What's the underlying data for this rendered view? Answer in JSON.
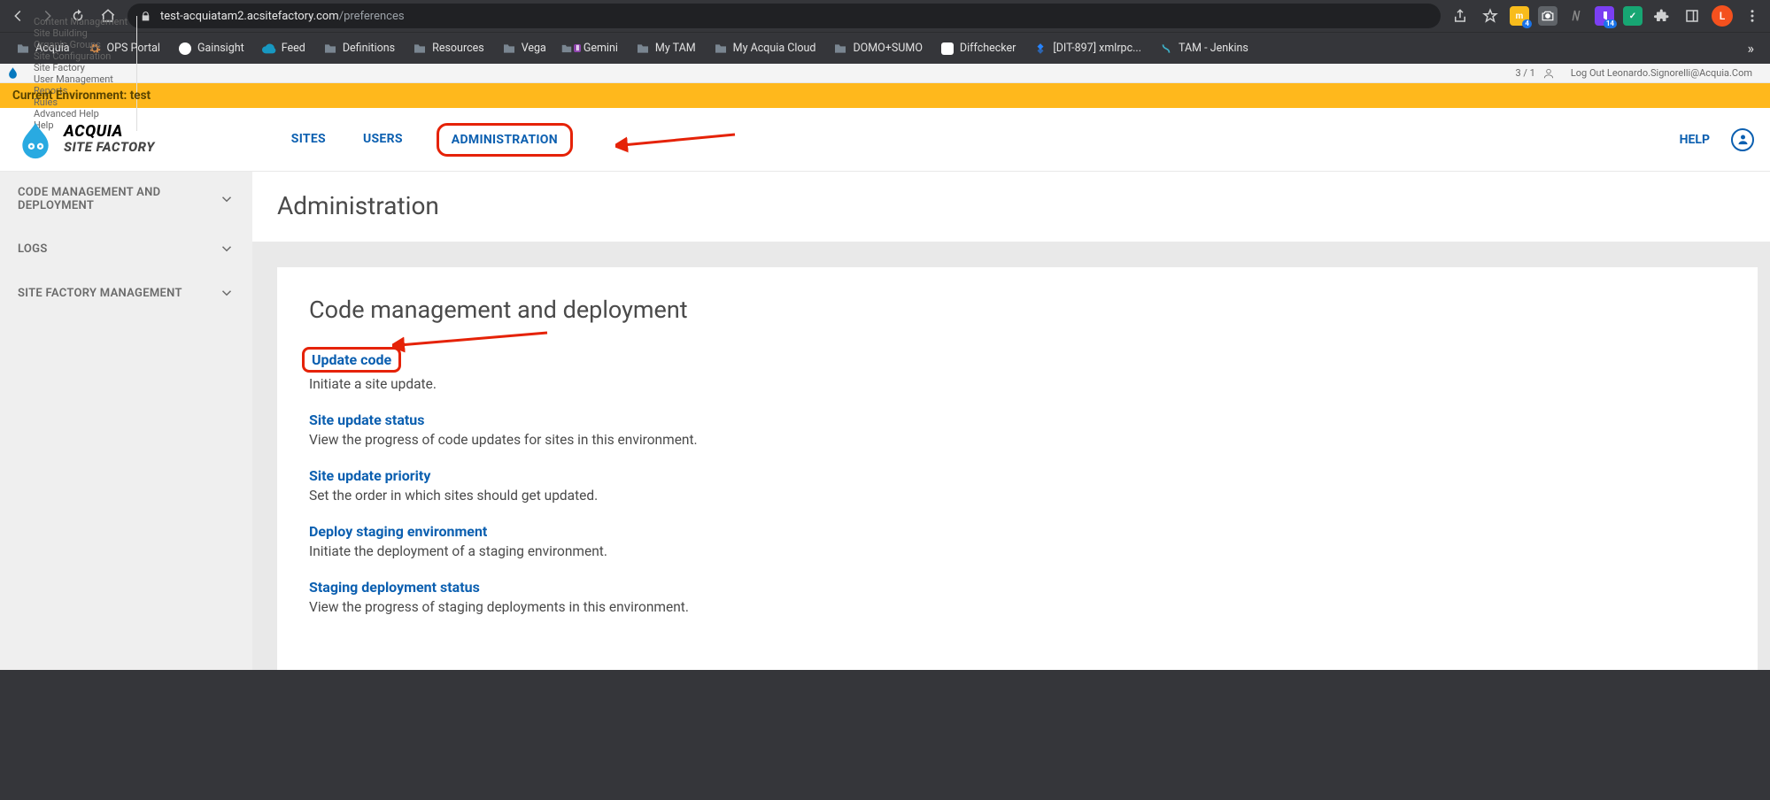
{
  "browser": {
    "url_host": "test-acquiatam2.acsitefactory.com",
    "url_path": "/preferences",
    "ext_badge_1": "4",
    "ext_badge_2": "14",
    "avatar_letter": "L",
    "more_bookmarks": "»"
  },
  "bookmarks": [
    {
      "label": "Acquia",
      "icon": "folder",
      "color": "#7a8691"
    },
    {
      "label": "OPS Portal",
      "icon": "gear",
      "color": "#d38b4b"
    },
    {
      "label": "Gainsight",
      "icon": "g",
      "color": "#3a88d8"
    },
    {
      "label": "Feed",
      "icon": "cloud",
      "color": "#1798c1"
    },
    {
      "label": "Definitions",
      "icon": "folder",
      "color": "#7a8691"
    },
    {
      "label": "Resources",
      "icon": "folder",
      "color": "#7a8691"
    },
    {
      "label": "Vega",
      "icon": "folder",
      "color": "#7a8691"
    },
    {
      "label": "Gemini",
      "icon": "gemini",
      "color": "#8e44ad"
    },
    {
      "label": "My TAM",
      "icon": "folder",
      "color": "#7a8691"
    },
    {
      "label": "My Acquia Cloud",
      "icon": "folder",
      "color": "#7a8691"
    },
    {
      "label": "DOMO+SUMO",
      "icon": "folder",
      "color": "#7a8691"
    },
    {
      "label": "Diffchecker",
      "icon": "d",
      "color": "#00b66c"
    },
    {
      "label": "[DIT-897] xmlrpc...",
      "icon": "jira",
      "color": "#2684ff"
    },
    {
      "label": "TAM - Jenkins",
      "icon": "jen",
      "color": "#3db1c8"
    }
  ],
  "admin_menu": [
    "Content Management",
    "Site Building",
    "Organic Groups",
    "Site Configuration",
    "Site Factory",
    "User Management",
    "Reports",
    "Rules",
    "Advanced Help",
    "Help"
  ],
  "admin_count": "3 / 1",
  "admin_logout": "Log Out Leonardo.Signorelli@Acquia.Com",
  "env_banner": "Current Environment: test",
  "brand": {
    "l1": "ACQUIA",
    "l2": "SITE FACTORY"
  },
  "tabs": {
    "sites": "SITES",
    "users": "USERS",
    "admin": "ADMINISTRATION",
    "help": "HELP"
  },
  "sidebar": [
    {
      "label": "CODE MANAGEMENT AND DEPLOYMENT"
    },
    {
      "label": "LOGS"
    },
    {
      "label": "SITE FACTORY MANAGEMENT"
    }
  ],
  "page_title": "Administration",
  "section_title": "Code management and deployment",
  "items": [
    {
      "title": "Update code",
      "desc": "Initiate a site update.",
      "annot": true
    },
    {
      "title": "Site update status",
      "desc": "View the progress of code updates for sites in this environment."
    },
    {
      "title": "Site update priority",
      "desc": "Set the order in which sites should get updated."
    },
    {
      "title": "Deploy staging environment",
      "desc": "Initiate the deployment of a staging environment."
    },
    {
      "title": "Staging deployment status",
      "desc": "View the progress of staging deployments in this environment."
    }
  ]
}
